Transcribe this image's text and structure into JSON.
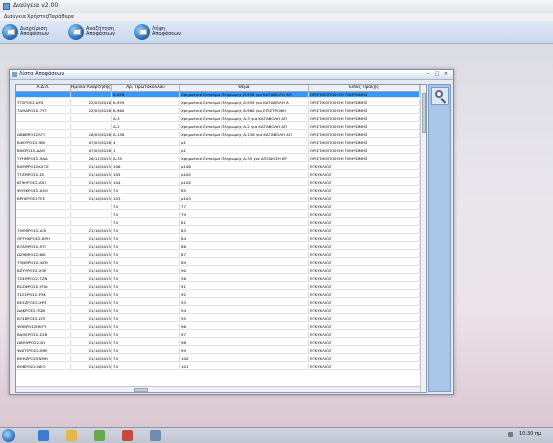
{
  "app": {
    "title": "Διαύγεια v2.00"
  },
  "menu": [
    "Διαύγεια",
    "Χρήστες",
    "Παράθυρα"
  ],
  "toolbar": [
    {
      "label_line1": "Διαχείριση",
      "label_line2": "Αποφάσεων"
    },
    {
      "label_line1": "Αναζήτηση",
      "label_line2": "Αποφάσεων"
    },
    {
      "label_line1": "Λήψη",
      "label_line2": "Αποφάσεων"
    }
  ],
  "window": {
    "title": "Λίστα Αποφάσεων",
    "minimize": "–",
    "maximize": "□",
    "close": "×"
  },
  "grid": {
    "columns": [
      "Α.Δ.Α.",
      "Ημ/νία Ανάρτησης",
      "Αρ. Πρωτοκόλλου",
      "Θέμα",
      "Είδος Πράξης"
    ],
    "rows": [
      {
        "ada": "",
        "date": "",
        "protocol": "8-958",
        "subject": "Χρηματικό Ενταλμα Πληρωμής 8-958 για ΚΑΤΑΒΟΛΗ ΑΠ",
        "type": "ΟΡΙΣΤΙΚΟΠΟΙΗΣΗ ΠΛΗΡΩΜΗΣ",
        "selected": true
      },
      {
        "ada": "7ΤΣΡΟΣ2-0Ρ4",
        "date": "22/03/2016",
        "protocol": "8-959",
        "subject": "Χρηματικό Ενταλμα Πληρωμής 8-959 για ΚΑΤΑΒΟΛΗ Α",
        "type": "ΟΡΙΣΤΙΚΟΠΟΙΗΣΗ ΠΛΗΡΩΜΗΣ",
        "selected": false
      },
      {
        "ada": "7ΑΘΔΡΟΣ2-7ΥΞ",
        "date": "22/03/2016",
        "protocol": "8-960",
        "subject": "Χρηματικό Ενταλμα Πληρωμής 8-960 για ΕΠΙΣΤΡΟΦΗ",
        "type": "ΟΡΙΣΤΙΚΟΠΟΙΗΣΗ ΠΛΗΡΩΜΗΣ",
        "selected": false
      },
      {
        "ada": "",
        "date": "",
        "protocol": "Α-3",
        "subject": "Χρηματικό Ενταλμα Πληρωμής Α-3 για ΚΑΤΑΒΟΛΗ ΑΠ",
        "type": "ΟΡΙΣΤΙΚΟΠΟΙΗΣΗ ΠΛΗΡΩΜΗΣ",
        "selected": false
      },
      {
        "ada": "",
        "date": "",
        "protocol": "Α-2",
        "subject": "Χρηματικό Ενταλμα Πληρωμής Α-2 για ΚΑΤΑΒΟΛΗ ΑΠ",
        "type": "ΟΡΙΣΤΙΚΟΠΟΙΗΣΗ ΠΛΗΡΩΜΗΣ",
        "selected": false
      },
      {
        "ada": "ΩΒ6ΒΡΟΣ2ΛΤΞ",
        "date": "18/03/2016",
        "protocol": "Α-158",
        "subject": "Χρηματικό Ενταλμα Πληρωμής Α-158 για ΚΑΤΑΒΟΛΗ ΑΠ",
        "type": "ΟΡΙΣΤΙΚΟΠΟΙΗΣΗ ΠΛΗΡΩΜΗΣ",
        "selected": false
      },
      {
        "ada": "Β4ΚΥΡΟΣ2-9ΒΙ",
        "date": "07/03/2016",
        "protocol": "4",
        "subject": "ρ1",
        "type": "ΟΡΙΣΤΙΚΟΠΟΙΗΣΗ ΠΛΗΡΩΜΗΣ",
        "selected": false
      },
      {
        "ada": "ΒΧΚΡΟΣ2-ΔΑΘ",
        "date": "07/03/2016",
        "protocol": "1",
        "subject": "ρ1",
        "type": "ΟΡΙΣΤΙΚΟΠΟΙΗΣΗ ΠΛΗΡΩΜΗΣ",
        "selected": false
      },
      {
        "ada": "7ΥΗΜΡΟΣ2-9ΑΔ",
        "date": "26/11/2015",
        "protocol": "Α-35",
        "subject": "Χρηματικό Ενταλμα Πληρωμής Α-35 για ΑΠΟΔΟΣΗ ΚΡ",
        "type": "ΟΡΙΣΤΙΚΟΠΟΙΗΣΗ ΠΛΗΡΩΜΗΣ",
        "selected": false
      },
      {
        "ada": "ΒΧΜΡΡΟΣ2ΚΧΞΖ",
        "date": "21/10/2015",
        "protocol": "106",
        "subject": "ρ106",
        "type": "ΕΓΚΥΚΛΙΟΣ",
        "selected": false
      },
      {
        "ada": "7ΤΖΜΡΟΣ2-ΣΙΙ",
        "date": "21/10/2015",
        "protocol": "105",
        "subject": "ρ105",
        "type": "ΕΓΚΥΚΛΙΟΣ",
        "selected": false
      },
      {
        "ada": "ΒΓ9ΗΡΟΣ2-ΑΧΞ",
        "date": "21/10/2015",
        "protocol": "104",
        "subject": "ρ104",
        "type": "ΕΓΚΥΚΛΙΟΣ",
        "selected": false
      },
      {
        "ada": "ΨΟ9ΚΡΟΣ2-04Ο",
        "date": "21/10/2015",
        "protocol": "74",
        "subject": "85",
        "type": "ΕΓΚΥΚΛΙΟΣ",
        "selected": false
      },
      {
        "ada": "ΒΡΗΕΡΟΣ2ΤΕΣ",
        "date": "21/10/2015",
        "protocol": "103",
        "subject": "ρ103",
        "type": "ΕΓΚΥΚΛΙΟΣ",
        "selected": false
      },
      {
        "ada": "",
        "date": "",
        "protocol": "74",
        "subject": "77",
        "type": "ΕΓΚΥΚΛΙΟΣ",
        "selected": false
      },
      {
        "ada": "",
        "date": "",
        "protocol": "74",
        "subject": "79",
        "type": "ΕΓΚΥΚΛΙΟΣ",
        "selected": false
      },
      {
        "ada": "",
        "date": "",
        "protocol": "74",
        "subject": "81",
        "type": "ΕΓΚΥΚΛΙΟΣ",
        "selected": false
      },
      {
        "ada": "7ΘΘ9ΡΟΣ2-Α3Ι",
        "date": "21/10/2015",
        "protocol": "74",
        "subject": "83",
        "type": "ΕΓΚΥΚΛΙΟΣ",
        "selected": false
      },
      {
        "ada": "ΟΡΤΗΚΡΟΣ2-8ΡΗ",
        "date": "21/10/2015",
        "protocol": "74",
        "subject": "84",
        "type": "ΕΓΚΥΚΛΙΟΣ",
        "selected": false
      },
      {
        "ada": "Β7ΑΘΡΟΣ2-9ΤΙ",
        "date": "21/10/2015",
        "protocol": "74",
        "subject": "86",
        "type": "ΕΓΚΥΚΛΙΟΣ",
        "selected": false
      },
      {
        "ada": "ΩΖ9ΒΡΟΣ2-6ΙΚ",
        "date": "21/10/2015",
        "protocol": "74",
        "subject": "87",
        "type": "ΕΓΚΥΚΛΙΟΣ",
        "selected": false
      },
      {
        "ada": "73ΝΘΡΟΣ2-4ΖΘ",
        "date": "21/10/2015",
        "protocol": "74",
        "subject": "89",
        "type": "ΕΓΚΥΚΛΙΟΣ",
        "selected": false
      },
      {
        "ada": "ΒΖΥΥΡΟΣ2-Χ3Ε",
        "date": "21/10/2015",
        "protocol": "74",
        "subject": "90",
        "type": "ΕΓΚΥΚΛΙΟΣ",
        "selected": false
      },
      {
        "ada": "7Ζ4ΘΡΟΣ2-ΤΖΝ",
        "date": "21/10/2015",
        "protocol": "74",
        "subject": "56",
        "type": "ΕΓΚΥΚΛΙΟΣ",
        "selected": false
      },
      {
        "ada": "Β1ΖΦΡΟΣ2-ΥΠΑ",
        "date": "21/10/2015",
        "protocol": "74",
        "subject": "91",
        "type": "ΕΓΚΥΚΛΙΟΣ",
        "selected": false
      },
      {
        "ada": "7ΣΣΣΡΟΣ2-Ρ3Κ",
        "date": "21/10/2015",
        "protocol": "74",
        "subject": "92",
        "type": "ΕΓΚΥΚΛΙΟΣ",
        "selected": false
      },
      {
        "ada": "ΒΕΣΖΡΟΣ2-ΧΡ3",
        "date": "21/10/2015",
        "protocol": "74",
        "subject": "93",
        "type": "ΕΓΚΥΚΛΙΟΣ",
        "selected": false
      },
      {
        "ada": "ΩΑΚΡΟΣ2-7ΩΒ",
        "date": "21/10/2015",
        "protocol": "74",
        "subject": "94",
        "type": "ΕΓΚΥΚΛΙΟΣ",
        "selected": false
      },
      {
        "ada": "Β748ΡΟΣ2-ΩΤΙ",
        "date": "21/10/2015",
        "protocol": "74",
        "subject": "95",
        "type": "ΕΓΚΥΚΛΙΟΣ",
        "selected": false
      },
      {
        "ada": "ΨΘΒΡΟΣ2ΗΚΤΥ",
        "date": "21/10/2015",
        "protocol": "74",
        "subject": "96",
        "type": "ΕΓΚΥΚΛΙΟΣ",
        "selected": false
      },
      {
        "ada": "ΒΑΘΕΡΟΣ2-Σ2Β",
        "date": "21/10/2015",
        "protocol": "74",
        "subject": "97",
        "type": "ΕΓΚΥΚΛΙΟΣ",
        "selected": false
      },
      {
        "ada": "ΩΒΗΨΡΟΣ2-Β1",
        "date": "21/10/2015",
        "protocol": "74",
        "subject": "98",
        "type": "ΕΓΚΥΚΛΙΟΣ",
        "selected": false
      },
      {
        "ada": "ΨΩΠΤΡΟΣ2-Β9Ε",
        "date": "21/10/2015",
        "protocol": "74",
        "subject": "99",
        "type": "ΕΓΚΥΚΛΙΟΣ",
        "selected": false
      },
      {
        "ada": "ΒΗΗΖΡΟΣ2ΝΜΗ",
        "date": "21/10/2015",
        "protocol": "74",
        "subject": "100",
        "type": "ΕΓΚΥΚΛΙΟΣ",
        "selected": false
      },
      {
        "ada": "ΒΘΒΡΟΣ2-ΝΕΟ",
        "date": "21/10/2015",
        "protocol": "74",
        "subject": "101",
        "type": "ΕΓΚΥΚΛΙΟΣ",
        "selected": false
      }
    ]
  },
  "taskbar": {
    "time": "10:30 πμ"
  },
  "colors": {
    "selection": "#3399ff",
    "panel": "#a9c6e8"
  }
}
